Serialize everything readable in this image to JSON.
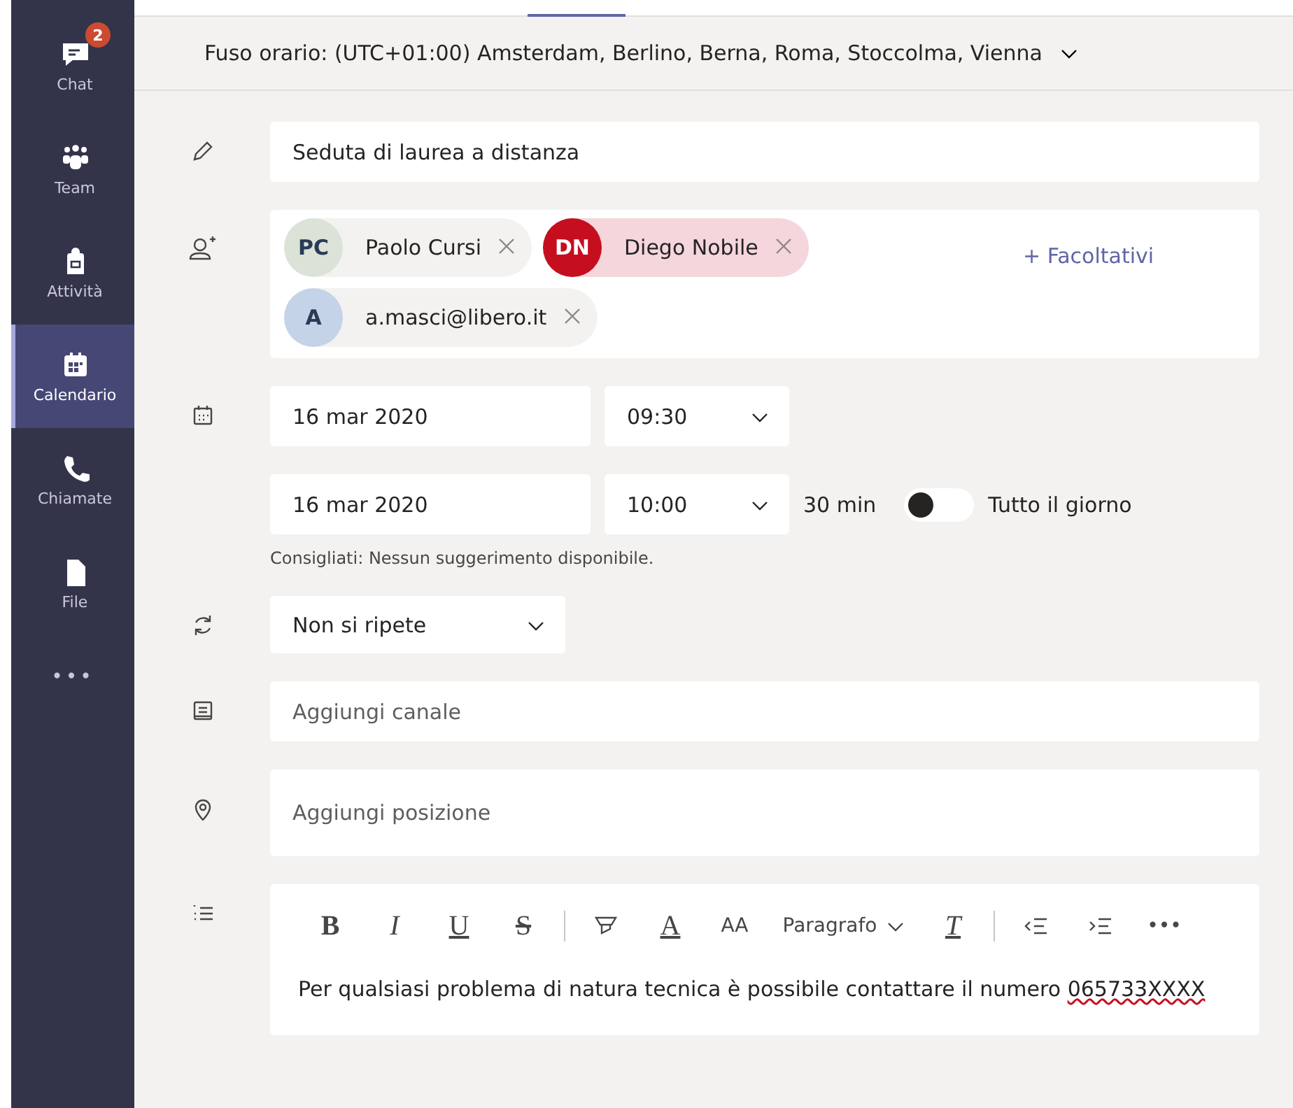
{
  "sidebar": {
    "items": [
      {
        "kind": "chat",
        "label": "Chat",
        "badge": "2",
        "selected": false
      },
      {
        "kind": "team",
        "label": "Team",
        "selected": false
      },
      {
        "kind": "activity",
        "label": "Attività",
        "selected": false
      },
      {
        "kind": "calendar",
        "label": "Calendario",
        "selected": true
      },
      {
        "kind": "calls",
        "label": "Chiamate",
        "selected": false
      },
      {
        "kind": "file",
        "label": "File",
        "selected": false
      }
    ],
    "more": "•••"
  },
  "timezone": "Fuso orario: (UTC+01:00) Amsterdam, Berlino, Berna, Roma, Stoccolma, Vienna",
  "title": {
    "value": "Seduta di laurea a distanza"
  },
  "attendees": {
    "chips": [
      {
        "initials": "PC",
        "name": "Paolo Cursi",
        "color": "#dbe3d8",
        "selected": false
      },
      {
        "initials": "DN",
        "name": "Diego Nobile",
        "color": "#c50f1f",
        "selected": true
      },
      {
        "initials": "A",
        "name": "a.masci@libero.it",
        "color": "#c5d3e8",
        "selected": false
      }
    ],
    "optional": "+ Facoltativi"
  },
  "start": {
    "date": "16 mar 2020",
    "time": "09:30"
  },
  "end": {
    "date": "16 mar 2020",
    "time": "10:00",
    "duration": "30 min"
  },
  "all_day": {
    "label": "Tutto il giorno",
    "on": false
  },
  "suggestion": "Consigliati: Nessun suggerimento disponibile.",
  "repeat": {
    "value": "Non si ripete"
  },
  "channel": {
    "placeholder": "Aggiungi canale"
  },
  "location": {
    "placeholder": "Aggiungi posizione"
  },
  "editor": {
    "toolbar": [
      {
        "kind": "bold",
        "text": "B"
      },
      {
        "kind": "italic",
        "text": "I"
      },
      {
        "kind": "underline",
        "text": "U"
      },
      {
        "kind": "strike",
        "text": "S"
      },
      {
        "kind": "separator"
      },
      {
        "kind": "highlight"
      },
      {
        "kind": "color",
        "text": "A"
      },
      {
        "kind": "size",
        "text": "AA"
      },
      {
        "kind": "dropdown",
        "text": "Paragrafo"
      },
      {
        "kind": "clear",
        "text": "T"
      },
      {
        "kind": "separator"
      },
      {
        "kind": "outdent"
      },
      {
        "kind": "indent"
      },
      {
        "kind": "more",
        "text": "•••"
      }
    ],
    "body": "Per qualsiasi problema di natura tecnica è possibile contattare il numero",
    "body_misspelled": "065733XXXX"
  }
}
